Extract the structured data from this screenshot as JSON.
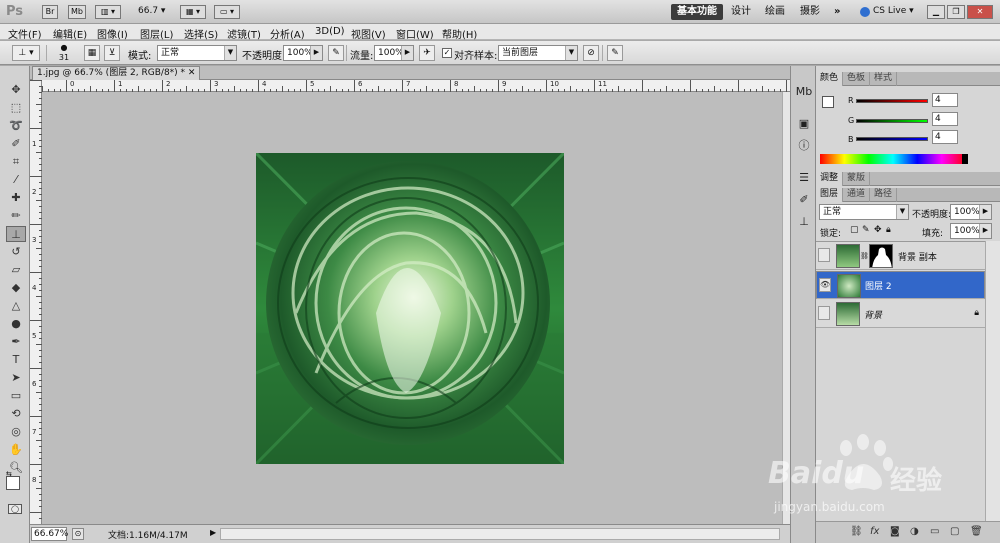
{
  "app": {
    "logo": "Ps",
    "bridge_btn": "Br",
    "minibridge_btn": "Mb",
    "zoom_value": "66.7",
    "workspaces": [
      "基本功能",
      "设计",
      "绘画",
      "摄影"
    ],
    "more": "»",
    "cslive": "CS Live"
  },
  "menu": [
    "文件(F)",
    "编辑(E)",
    "图像(I)",
    "图层(L)",
    "选择(S)",
    "滤镜(T)",
    "分析(A)",
    "3D(D)",
    "视图(V)",
    "窗口(W)",
    "帮助(H)"
  ],
  "options": {
    "brush_size": "31",
    "mode_label": "模式:",
    "mode_value": "正常",
    "opacity_label": "不透明度:",
    "opacity_value": "100%",
    "flow_label": "流量:",
    "flow_value": "100%",
    "aligned_label": "对齐",
    "sample_label": "样本:",
    "sample_value": "当前图层"
  },
  "document": {
    "tab_title": "1.jpg @ 66.7% (图层 2, RGB/8*) *",
    "ruler_h": [
      "0",
      "1",
      "2",
      "3",
      "4",
      "5",
      "6",
      "7",
      "8",
      "9",
      "10",
      "11"
    ],
    "ruler_v": [
      "1",
      "2",
      "3",
      "4",
      "5",
      "6",
      "7",
      "8"
    ],
    "zoom": "66.67%",
    "doc_info": "文档:1.16M/4.17M"
  },
  "color_panel": {
    "tabs": [
      "颜色",
      "色板",
      "样式"
    ],
    "r_label": "R",
    "g_label": "G",
    "b_label": "B",
    "r": "4",
    "g": "4",
    "b": "4"
  },
  "adjust_panel": {
    "tabs": [
      "调整",
      "蒙版"
    ]
  },
  "layers_panel": {
    "tabs": [
      "图层",
      "通道",
      "路径"
    ],
    "blend_mode": "正常",
    "opacity_label": "不透明度:",
    "opacity": "100%",
    "lock_label": "锁定:",
    "fill_label": "填充:",
    "fill": "100%",
    "layers": [
      {
        "name": "背景 副本",
        "visible": false,
        "selected": false,
        "has_mask": true
      },
      {
        "name": "图层 2",
        "visible": true,
        "selected": true,
        "has_mask": false
      },
      {
        "name": "背景",
        "visible": false,
        "selected": false,
        "locked": true
      }
    ]
  },
  "watermark": {
    "brand": "Baidu",
    "brand_cn": "经验",
    "url": "jingyan.baidu.com"
  },
  "colors": {
    "accent": "#3267c9",
    "image_green": "#2e7a3a"
  }
}
